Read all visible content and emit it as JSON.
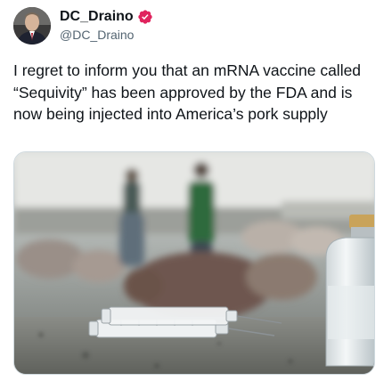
{
  "author": {
    "display_name": "DC_Draino",
    "handle": "@DC_Draino",
    "verified": true,
    "verified_color": "#e0245e"
  },
  "tweet": {
    "text": "I regret to inform you that an mRNA vaccine called “Sequivity” has been approved by the FDA and is now being injected into America’s pork supply"
  },
  "media": {
    "kind": "photo",
    "subject": "syringe-and-vial-in-pig-barn"
  },
  "icons": {
    "verified": "verified-badge-icon"
  }
}
